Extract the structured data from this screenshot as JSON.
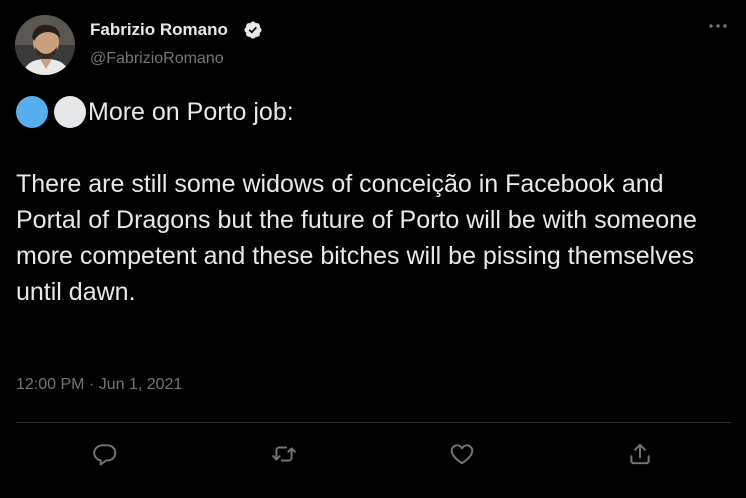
{
  "tweet": {
    "author": {
      "name": "Fabrizio Romano",
      "handle": "@FabrizioRomano",
      "verified_icon": "verified-badge-icon"
    },
    "menu_icon": "more-options-icon",
    "intro_emojis": [
      {
        "icon": "blue-circle-emoji",
        "color": "#55acee"
      },
      {
        "icon": "white-circle-emoji",
        "color": "#e6e7e8"
      }
    ],
    "intro_text": "More on Porto job:",
    "body_text": "There are still some widows of conceição in Facebook and Portal of Dragons but the future of Porto will be with someone more competent and these bitches will be pissing themselves until dawn.",
    "timestamp": "12:00 PM · Jun 1, 2021",
    "actions": [
      {
        "name": "reply",
        "icon": "reply-icon"
      },
      {
        "name": "retweet",
        "icon": "retweet-icon"
      },
      {
        "name": "like",
        "icon": "heart-icon"
      },
      {
        "name": "share",
        "icon": "share-icon"
      }
    ]
  },
  "colors": {
    "background": "#000000",
    "text_primary": "#e7e9ea",
    "text_secondary": "#71767b",
    "divider": "#2f3336",
    "icon": "#71767b"
  }
}
